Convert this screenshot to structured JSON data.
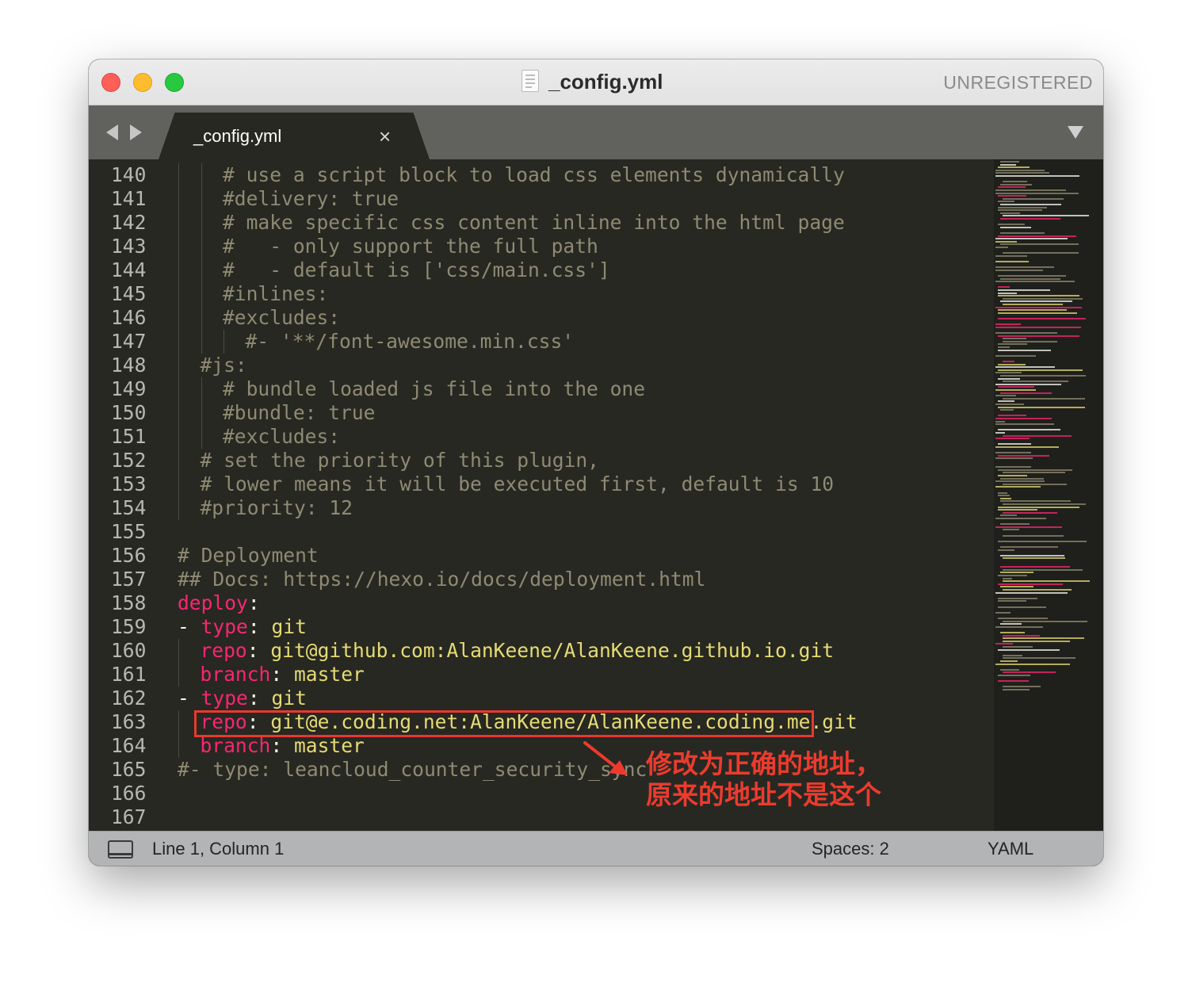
{
  "window": {
    "title": "_config.yml",
    "registration_status": "UNREGISTERED"
  },
  "tabs": [
    {
      "label": "_config.yml",
      "close_glyph": "×"
    }
  ],
  "editor": {
    "lines": [
      {
        "num": "140",
        "indent": 2,
        "segments": [
          {
            "t": "# use a script block to load css elements dynamically",
            "c": "c"
          }
        ]
      },
      {
        "num": "141",
        "indent": 2,
        "segments": [
          {
            "t": "#delivery: true",
            "c": "c"
          }
        ]
      },
      {
        "num": "142",
        "indent": 2,
        "segments": [
          {
            "t": "# make specific css content inline into the html page",
            "c": "c"
          }
        ]
      },
      {
        "num": "143",
        "indent": 2,
        "segments": [
          {
            "t": "#   - only support the full path",
            "c": "c"
          }
        ]
      },
      {
        "num": "144",
        "indent": 2,
        "segments": [
          {
            "t": "#   - default is ['css/main.css']",
            "c": "c"
          }
        ]
      },
      {
        "num": "145",
        "indent": 2,
        "segments": [
          {
            "t": "#inlines:",
            "c": "c"
          }
        ]
      },
      {
        "num": "146",
        "indent": 2,
        "segments": [
          {
            "t": "#excludes:",
            "c": "c"
          }
        ]
      },
      {
        "num": "147",
        "indent": 3,
        "segments": [
          {
            "t": "#- '**/font-awesome.min.css'",
            "c": "c"
          }
        ]
      },
      {
        "num": "148",
        "indent": 1,
        "segments": [
          {
            "t": "#js:",
            "c": "c"
          }
        ]
      },
      {
        "num": "149",
        "indent": 2,
        "segments": [
          {
            "t": "# bundle loaded js file into the one",
            "c": "c"
          }
        ]
      },
      {
        "num": "150",
        "indent": 2,
        "segments": [
          {
            "t": "#bundle: true",
            "c": "c"
          }
        ]
      },
      {
        "num": "151",
        "indent": 2,
        "segments": [
          {
            "t": "#excludes:",
            "c": "c"
          }
        ]
      },
      {
        "num": "152",
        "indent": 1,
        "segments": [
          {
            "t": "# set the priority of this plugin,",
            "c": "c"
          }
        ]
      },
      {
        "num": "153",
        "indent": 1,
        "segments": [
          {
            "t": "# lower means it will be executed first, default is 10",
            "c": "c"
          }
        ]
      },
      {
        "num": "154",
        "indent": 1,
        "segments": [
          {
            "t": "#priority: 12",
            "c": "c"
          }
        ]
      },
      {
        "num": "155",
        "indent": 0,
        "segments": []
      },
      {
        "num": "156",
        "indent": 0,
        "segments": [
          {
            "t": "# Deployment",
            "c": "c"
          }
        ]
      },
      {
        "num": "157",
        "indent": 0,
        "segments": [
          {
            "t": "## Docs: https://hexo.io/docs/deployment.html",
            "c": "c"
          }
        ]
      },
      {
        "num": "158",
        "indent": 0,
        "segments": [
          {
            "t": "deploy",
            "c": "k"
          },
          {
            "t": ":",
            "c": "p"
          }
        ]
      },
      {
        "num": "159",
        "indent": 0,
        "segments": [
          {
            "t": "- ",
            "c": "p"
          },
          {
            "t": "type",
            "c": "k"
          },
          {
            "t": ": ",
            "c": "p"
          },
          {
            "t": "git",
            "c": "s"
          }
        ]
      },
      {
        "num": "160",
        "indent": 1,
        "segments": [
          {
            "t": "repo",
            "c": "k"
          },
          {
            "t": ": ",
            "c": "p"
          },
          {
            "t": "git@github.com:AlanKeene/AlanKeene.github.io.git",
            "c": "s"
          }
        ]
      },
      {
        "num": "161",
        "indent": 1,
        "segments": [
          {
            "t": "branch",
            "c": "k"
          },
          {
            "t": ": ",
            "c": "p"
          },
          {
            "t": "master",
            "c": "s"
          }
        ]
      },
      {
        "num": "162",
        "indent": 0,
        "segments": [
          {
            "t": "- ",
            "c": "p"
          },
          {
            "t": "type",
            "c": "k"
          },
          {
            "t": ": ",
            "c": "p"
          },
          {
            "t": "git",
            "c": "s"
          }
        ]
      },
      {
        "num": "163",
        "indent": 1,
        "segments": [
          {
            "t": "repo",
            "c": "k"
          },
          {
            "t": ": ",
            "c": "p"
          },
          {
            "t": "git@e.coding.net:AlanKeene/AlanKeene.coding.me.git",
            "c": "s"
          }
        ]
      },
      {
        "num": "164",
        "indent": 1,
        "segments": [
          {
            "t": "branch",
            "c": "k"
          },
          {
            "t": ": ",
            "c": "p"
          },
          {
            "t": "master",
            "c": "s"
          }
        ]
      },
      {
        "num": "165",
        "indent": 0,
        "segments": [
          {
            "t": "#- type: leancloud_counter_security_sync",
            "c": "c"
          }
        ]
      },
      {
        "num": "166",
        "indent": 0,
        "segments": []
      },
      {
        "num": "167",
        "indent": 0,
        "segments": []
      }
    ]
  },
  "annotation": {
    "lines": [
      "修改为正确的地址，",
      "原来的地址不是这个"
    ],
    "color": "#ec3b2e"
  },
  "statusbar": {
    "position": "Line 1, Column 1",
    "indentation": "Spaces: 2",
    "syntax": "YAML"
  },
  "colors": {
    "editor_bg": "#272822",
    "comment": "#8f8a73",
    "keyword": "#f92672",
    "string": "#e6db74",
    "plain": "#f8f8f2"
  }
}
